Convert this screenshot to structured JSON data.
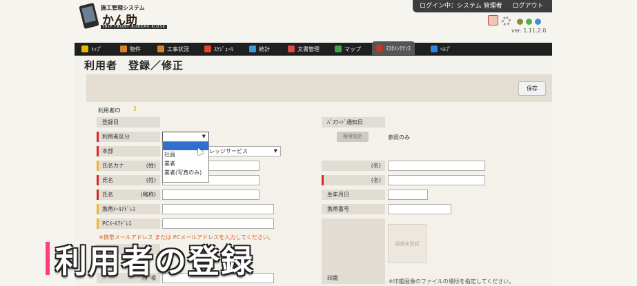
{
  "app": {
    "subtitle": "施工管理システム",
    "name": "かん助",
    "tagline": "TRIP FRONT BUREAU KIOSK"
  },
  "login": {
    "status": "ログイン中：システム 管理者",
    "logout": "ログアウト"
  },
  "version": "ver. 1.11.2.0",
  "status_dots": [
    "#8a8a3a",
    "#4caf50",
    "#3a8fd6"
  ],
  "nav": [
    {
      "label": "ﾄｯﾌﾟ",
      "icon": "top-icon",
      "color": "#e6b800"
    },
    {
      "label": "物件",
      "icon": "house-icon",
      "color": "#d9822b"
    },
    {
      "label": "工事状況",
      "icon": "house-icon",
      "color": "#d9822b"
    },
    {
      "label": "ｽｹｼﾞｭｰﾙ",
      "icon": "flag-icon",
      "color": "#e0452f"
    },
    {
      "label": "統計",
      "icon": "chart-icon",
      "color": "#3a9ad9"
    },
    {
      "label": "文書管理",
      "icon": "document-icon",
      "color": "#d94a4a"
    },
    {
      "label": "マップ",
      "icon": "map-icon",
      "color": "#3fa34d"
    },
    {
      "label": "ﾏｽﾀﾒﾝﾃﾅﾝｽ",
      "icon": "wrench-icon",
      "color": "#c0392b"
    },
    {
      "label": "ﾍﾙﾌﾟ",
      "icon": "help-icon",
      "color": "#2e86de"
    }
  ],
  "page_title": "利用者　登録／修正",
  "toolbar": {
    "save_label": "保存"
  },
  "form": {
    "user_id_label": "利用者ID",
    "registered_date_label": "登録日",
    "password_notify_label": "ﾊﾟｽﾜｰﾄﾞ通知日",
    "user_type_label": "利用者区分",
    "user_type_value": "",
    "permission_button": "権限設定",
    "permission_value": "参照のみ",
    "headquarters_label": "本部",
    "headquarters_value": "レッジサービス",
    "name_kana_label": "氏名カナ",
    "last_paren": "(姓)",
    "first_paren": "(名)",
    "name_label": "氏名",
    "alias_label": "氏名",
    "alias_paren": "(略称)",
    "birthdate_label": "生年月日",
    "mobile_mail_label": "携帯ﾒｰﾙｱﾄﾞﾚｽ",
    "mobile_phone_label": "携帯番号",
    "pc_mail_label": "PCﾒｰﾙｱﾄﾞﾚｽ",
    "mail_note": "※携帯メールアドレス または PCメールアドレスを入力してください。",
    "seal_label": "印鑑",
    "photo_placeholder": "画像未登録",
    "seal_note": "※印鑑画像のファイルの場所を指定してください。",
    "partial_label": "所",
    "partial_label2": "噴"
  },
  "dropdown_options": [
    "",
    "社員",
    "業者",
    "業者(写真のみ)"
  ],
  "caption": "利用者の登録"
}
